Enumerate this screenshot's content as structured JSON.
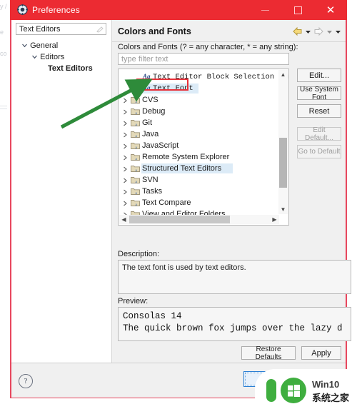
{
  "window": {
    "title": "Preferences",
    "icon": "preferences-gear-icon",
    "minimize_label": "Minimize",
    "maximize_label": "Maximize",
    "close_label": "Close",
    "titlebar_color": "#ec2b32"
  },
  "sidebar": {
    "filter": {
      "value": "Text Editors",
      "clear_icon": "clear-icon"
    },
    "tree": [
      {
        "label": "General",
        "level": 0,
        "expanded": true,
        "selected": false
      },
      {
        "label": "Editors",
        "level": 1,
        "expanded": true,
        "selected": false
      },
      {
        "label": "Text Editors",
        "level": 2,
        "expanded": false,
        "selected": true
      }
    ]
  },
  "main": {
    "title": "Colors and Fonts",
    "nav": {
      "back_icon": "back-arrow-icon",
      "back_menu_icon": "chevron-down-icon",
      "forward_icon": "forward-arrow-icon",
      "forward_menu_icon": "chevron-down-icon",
      "menu_icon": "chevron-down-icon"
    },
    "group_label": "Colors and Fonts (? = any character, * = any string):",
    "filter": {
      "placeholder": "type filter text",
      "value": ""
    },
    "list": [
      {
        "label": "Text Editor Block Selection Font",
        "type": "font",
        "indent": 34,
        "selected": false,
        "highlight": false
      },
      {
        "label": "Text Font",
        "type": "font",
        "indent": 34,
        "selected": true,
        "highlight": true
      },
      {
        "label": "CVS",
        "type": "folder",
        "indent": 17,
        "selected": false,
        "highlight": false
      },
      {
        "label": "Debug",
        "type": "folder",
        "indent": 17,
        "selected": false,
        "highlight": false
      },
      {
        "label": "Git",
        "type": "folder",
        "indent": 17,
        "selected": false,
        "highlight": false
      },
      {
        "label": "Java",
        "type": "folder",
        "indent": 17,
        "selected": false,
        "highlight": false
      },
      {
        "label": "JavaScript",
        "type": "folder",
        "indent": 17,
        "selected": false,
        "highlight": false
      },
      {
        "label": "Remote System Explorer",
        "type": "folder",
        "indent": 17,
        "selected": false,
        "highlight": false
      },
      {
        "label": "Structured Text Editors",
        "type": "folder",
        "indent": 17,
        "selected": false,
        "highlight": true
      },
      {
        "label": "SVN",
        "type": "folder",
        "indent": 17,
        "selected": false,
        "highlight": false
      },
      {
        "label": "Tasks",
        "type": "folder",
        "indent": 17,
        "selected": false,
        "highlight": false
      },
      {
        "label": "Text Compare",
        "type": "folder",
        "indent": 17,
        "selected": false,
        "highlight": false
      },
      {
        "label": "View and Editor Folders",
        "type": "folder",
        "indent": 17,
        "selected": false,
        "highlight": false
      }
    ],
    "buttons": [
      {
        "label": "Edit...",
        "enabled": true
      },
      {
        "label": "Use System Font",
        "enabled": true
      },
      {
        "label": "Reset",
        "enabled": true
      },
      {
        "label": "Edit Default...",
        "enabled": false
      },
      {
        "label": "Go to Default",
        "enabled": false
      }
    ],
    "description_label": "Description:",
    "description_text": "The text font is used by text editors.",
    "preview_label": "Preview:",
    "preview_lines": [
      "Consolas 14",
      "The quick brown fox jumps over the lazy d"
    ]
  },
  "footer": {
    "help_label": "?",
    "restore_defaults": "Restore Defaults",
    "apply": "Apply",
    "ok": "OK"
  },
  "watermark": {
    "line1": "Win10",
    "line2": "系统之家",
    "logo_icon": "win10-logo-icon",
    "color": "#3fae3f"
  },
  "annotation": {
    "highlight_box": "red-rectangle-around-text-font",
    "arrow": "green-arrow-pointing-to-text-font",
    "arrow_color": "#2e8b3a",
    "box_color": "#e8313a"
  }
}
